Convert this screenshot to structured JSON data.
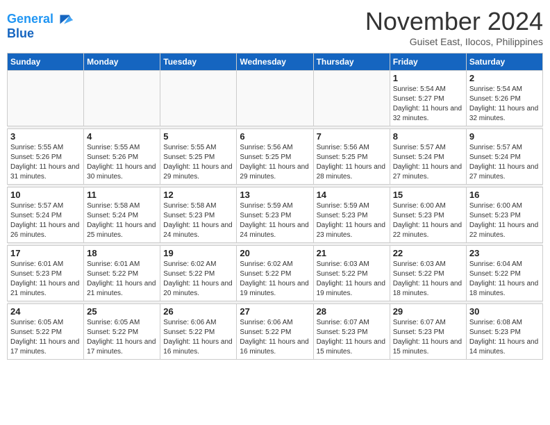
{
  "header": {
    "logo_line1": "General",
    "logo_line2": "Blue",
    "month": "November 2024",
    "location": "Guiset East, Ilocos, Philippines"
  },
  "weekdays": [
    "Sunday",
    "Monday",
    "Tuesday",
    "Wednesday",
    "Thursday",
    "Friday",
    "Saturday"
  ],
  "weeks": [
    [
      {
        "day": "",
        "info": ""
      },
      {
        "day": "",
        "info": ""
      },
      {
        "day": "",
        "info": ""
      },
      {
        "day": "",
        "info": ""
      },
      {
        "day": "",
        "info": ""
      },
      {
        "day": "1",
        "info": "Sunrise: 5:54 AM\nSunset: 5:27 PM\nDaylight: 11 hours and 32 minutes."
      },
      {
        "day": "2",
        "info": "Sunrise: 5:54 AM\nSunset: 5:26 PM\nDaylight: 11 hours and 32 minutes."
      }
    ],
    [
      {
        "day": "3",
        "info": "Sunrise: 5:55 AM\nSunset: 5:26 PM\nDaylight: 11 hours and 31 minutes."
      },
      {
        "day": "4",
        "info": "Sunrise: 5:55 AM\nSunset: 5:26 PM\nDaylight: 11 hours and 30 minutes."
      },
      {
        "day": "5",
        "info": "Sunrise: 5:55 AM\nSunset: 5:25 PM\nDaylight: 11 hours and 29 minutes."
      },
      {
        "day": "6",
        "info": "Sunrise: 5:56 AM\nSunset: 5:25 PM\nDaylight: 11 hours and 29 minutes."
      },
      {
        "day": "7",
        "info": "Sunrise: 5:56 AM\nSunset: 5:25 PM\nDaylight: 11 hours and 28 minutes."
      },
      {
        "day": "8",
        "info": "Sunrise: 5:57 AM\nSunset: 5:24 PM\nDaylight: 11 hours and 27 minutes."
      },
      {
        "day": "9",
        "info": "Sunrise: 5:57 AM\nSunset: 5:24 PM\nDaylight: 11 hours and 27 minutes."
      }
    ],
    [
      {
        "day": "10",
        "info": "Sunrise: 5:57 AM\nSunset: 5:24 PM\nDaylight: 11 hours and 26 minutes."
      },
      {
        "day": "11",
        "info": "Sunrise: 5:58 AM\nSunset: 5:24 PM\nDaylight: 11 hours and 25 minutes."
      },
      {
        "day": "12",
        "info": "Sunrise: 5:58 AM\nSunset: 5:23 PM\nDaylight: 11 hours and 24 minutes."
      },
      {
        "day": "13",
        "info": "Sunrise: 5:59 AM\nSunset: 5:23 PM\nDaylight: 11 hours and 24 minutes."
      },
      {
        "day": "14",
        "info": "Sunrise: 5:59 AM\nSunset: 5:23 PM\nDaylight: 11 hours and 23 minutes."
      },
      {
        "day": "15",
        "info": "Sunrise: 6:00 AM\nSunset: 5:23 PM\nDaylight: 11 hours and 22 minutes."
      },
      {
        "day": "16",
        "info": "Sunrise: 6:00 AM\nSunset: 5:23 PM\nDaylight: 11 hours and 22 minutes."
      }
    ],
    [
      {
        "day": "17",
        "info": "Sunrise: 6:01 AM\nSunset: 5:23 PM\nDaylight: 11 hours and 21 minutes."
      },
      {
        "day": "18",
        "info": "Sunrise: 6:01 AM\nSunset: 5:22 PM\nDaylight: 11 hours and 21 minutes."
      },
      {
        "day": "19",
        "info": "Sunrise: 6:02 AM\nSunset: 5:22 PM\nDaylight: 11 hours and 20 minutes."
      },
      {
        "day": "20",
        "info": "Sunrise: 6:02 AM\nSunset: 5:22 PM\nDaylight: 11 hours and 19 minutes."
      },
      {
        "day": "21",
        "info": "Sunrise: 6:03 AM\nSunset: 5:22 PM\nDaylight: 11 hours and 19 minutes."
      },
      {
        "day": "22",
        "info": "Sunrise: 6:03 AM\nSunset: 5:22 PM\nDaylight: 11 hours and 18 minutes."
      },
      {
        "day": "23",
        "info": "Sunrise: 6:04 AM\nSunset: 5:22 PM\nDaylight: 11 hours and 18 minutes."
      }
    ],
    [
      {
        "day": "24",
        "info": "Sunrise: 6:05 AM\nSunset: 5:22 PM\nDaylight: 11 hours and 17 minutes."
      },
      {
        "day": "25",
        "info": "Sunrise: 6:05 AM\nSunset: 5:22 PM\nDaylight: 11 hours and 17 minutes."
      },
      {
        "day": "26",
        "info": "Sunrise: 6:06 AM\nSunset: 5:22 PM\nDaylight: 11 hours and 16 minutes."
      },
      {
        "day": "27",
        "info": "Sunrise: 6:06 AM\nSunset: 5:22 PM\nDaylight: 11 hours and 16 minutes."
      },
      {
        "day": "28",
        "info": "Sunrise: 6:07 AM\nSunset: 5:23 PM\nDaylight: 11 hours and 15 minutes."
      },
      {
        "day": "29",
        "info": "Sunrise: 6:07 AM\nSunset: 5:23 PM\nDaylight: 11 hours and 15 minutes."
      },
      {
        "day": "30",
        "info": "Sunrise: 6:08 AM\nSunset: 5:23 PM\nDaylight: 11 hours and 14 minutes."
      }
    ]
  ]
}
